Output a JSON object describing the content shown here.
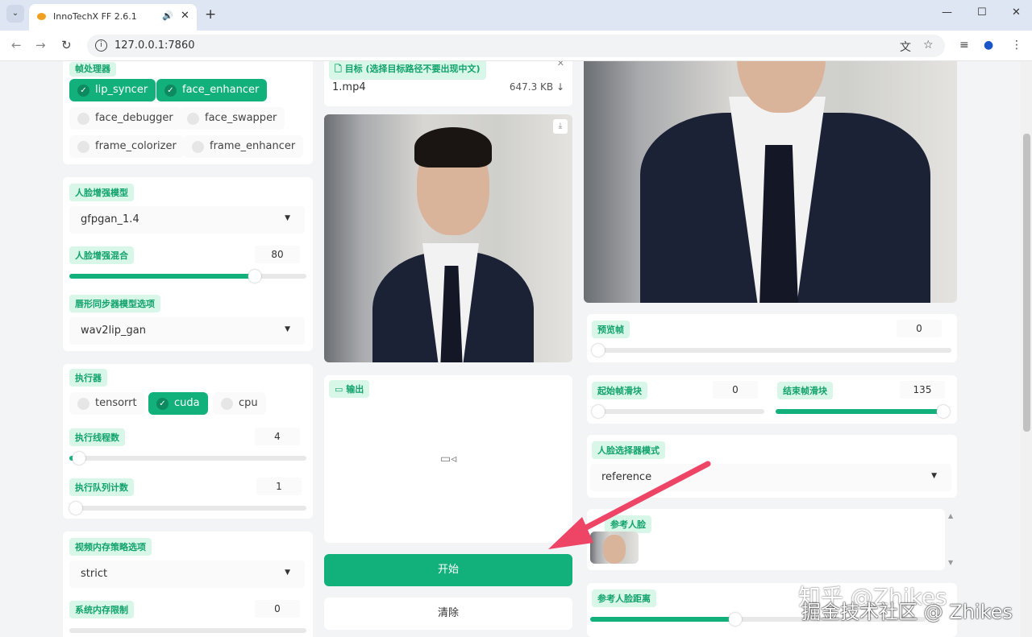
{
  "browser": {
    "tab_title": "InnoTechX FF 2.6.1",
    "url": "127.0.0.1:7860"
  },
  "left": {
    "processors": {
      "label": "帧处理器",
      "items": [
        {
          "label": "lip_syncer",
          "checked": true
        },
        {
          "label": "face_enhancer",
          "checked": true
        },
        {
          "label": "face_debugger",
          "checked": false
        },
        {
          "label": "face_swapper",
          "checked": false
        },
        {
          "label": "frame_colorizer",
          "checked": false
        },
        {
          "label": "frame_enhancer",
          "checked": false
        }
      ]
    },
    "face_enhancer_model": {
      "label": "人脸增强模型",
      "value": "gfpgan_1.4"
    },
    "face_enhancer_blend": {
      "label": "人脸增强混合",
      "value": "80",
      "percent": 80
    },
    "lip_syncer_model": {
      "label": "唇形同步器模型选项",
      "value": "wav2lip_gan"
    },
    "execution": {
      "label": "执行器",
      "items": [
        {
          "label": "tensorrt",
          "checked": false
        },
        {
          "label": "cuda",
          "checked": true
        },
        {
          "label": "cpu",
          "checked": false
        }
      ]
    },
    "thread_count": {
      "label": "执行线程数",
      "value": "4",
      "percent": 2
    },
    "queue_count": {
      "label": "执行队列计数",
      "value": "1",
      "percent": 0
    },
    "video_memory": {
      "label": "视频内存策略选项",
      "value": "strict"
    },
    "system_memory": {
      "label": "系统内存限制",
      "value": "0"
    }
  },
  "middle": {
    "target": {
      "label": "目标 (选择目标路径不要出现中文)",
      "file": "1.mp4",
      "size": "647.3 KB ↓"
    },
    "output": {
      "label": "输出"
    },
    "start_button": "开始",
    "clear_button": "清除"
  },
  "right": {
    "preview_frame": {
      "label": "预览帧",
      "value": "0"
    },
    "trim_start": {
      "label": "起始帧滑块",
      "value": "0"
    },
    "trim_end": {
      "label": "结束帧滑块",
      "value": "135",
      "percent": 100
    },
    "face_selector_mode": {
      "label": "人脸选择器模式",
      "value": "reference"
    },
    "reference_face": {
      "label": "参考人脸"
    },
    "reference_distance": {
      "label": "参考人脸距离",
      "percent": 40
    }
  },
  "watermark": {
    "line1": "知乎 @Zhikes",
    "line2": "掘金技术社区 @ Zhikes"
  },
  "colors": {
    "accent": "#12b07a",
    "label_bg": "#d9f7e8",
    "arrow": "#ee4466"
  }
}
